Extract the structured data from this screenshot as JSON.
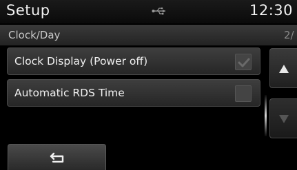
{
  "header": {
    "title": "Setup",
    "clock": "12:30",
    "status_icon": "usb-icon"
  },
  "subheader": {
    "title": "Clock/Day",
    "page_indicator": "2/"
  },
  "items": [
    {
      "label": "Clock Display (Power off)",
      "checked": true
    },
    {
      "label": "Automatic RDS Time",
      "checked": false
    }
  ],
  "scroll": {
    "up_icon": "triangle-up-icon",
    "down_icon": "triangle-down-icon"
  },
  "footer": {
    "back_icon": "back-arrow-icon"
  }
}
